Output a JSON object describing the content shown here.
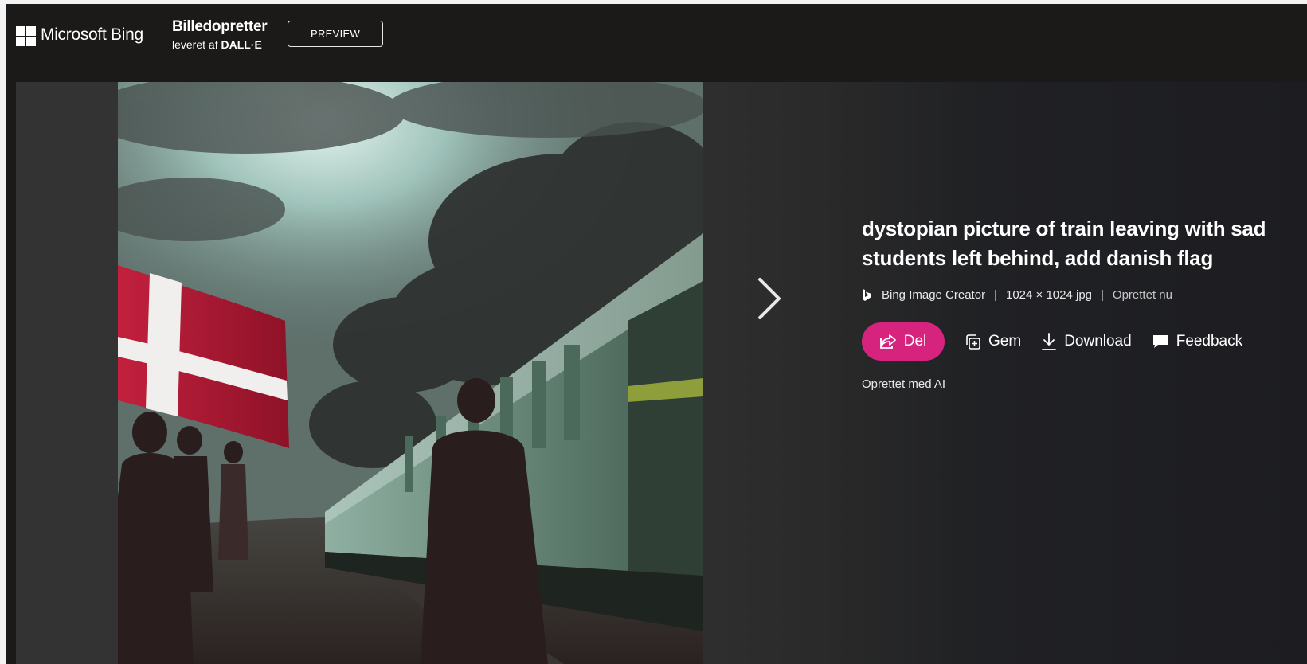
{
  "header": {
    "brand": "Microsoft Bing",
    "product_title": "Billedopretter",
    "product_sub_prefix": "leveret af",
    "product_sub_model": "DALL·E",
    "preview_label": "PREVIEW"
  },
  "image": {
    "alt": "dystopian picture of train leaving with sad students left behind, add danish flag"
  },
  "details": {
    "prompt_line1": "dystopian picture of train leaving with sad",
    "prompt_line2": "students left behind, add danish flag",
    "source": "Bing Image Creator",
    "dimensions": "1024 × 1024 jpg",
    "created": "Oprettet nu",
    "created_ai": "Oprettet med AI"
  },
  "actions": {
    "share_label": "Del",
    "save_label": "Gem",
    "download_label": "Download",
    "feedback_label": "Feedback"
  },
  "colors": {
    "accent": "#d6237e",
    "background": "#1b1a19"
  }
}
